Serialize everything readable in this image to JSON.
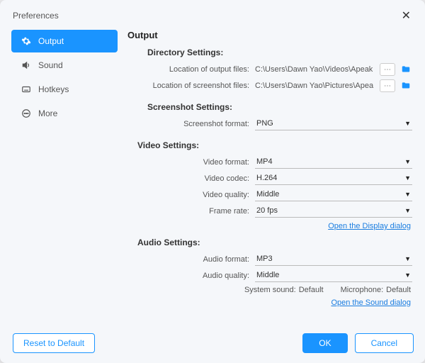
{
  "title": "Preferences",
  "sidebar": {
    "items": [
      {
        "label": "Output"
      },
      {
        "label": "Sound"
      },
      {
        "label": "Hotkeys"
      },
      {
        "label": "More"
      }
    ]
  },
  "main": {
    "heading": "Output",
    "directory": {
      "title": "Directory Settings:",
      "output_label": "Location of output files:",
      "output_path": "C:\\Users\\Dawn Yao\\Videos\\Apeak",
      "screenshot_label": "Location of screenshot files:",
      "screenshot_path": "C:\\Users\\Dawn Yao\\Pictures\\Apea"
    },
    "screenshot": {
      "title": "Screenshot Settings:",
      "format_label": "Screenshot format:",
      "format_value": "PNG"
    },
    "video": {
      "title": "Video Settings:",
      "format_label": "Video format:",
      "format_value": "MP4",
      "codec_label": "Video codec:",
      "codec_value": "H.264",
      "quality_label": "Video quality:",
      "quality_value": "Middle",
      "frame_label": "Frame rate:",
      "frame_value": "20 fps",
      "display_link": "Open the Display dialog"
    },
    "audio": {
      "title": "Audio Settings:",
      "format_label": "Audio format:",
      "format_value": "MP3",
      "quality_label": "Audio quality:",
      "quality_value": "Middle",
      "system_label": "System sound:",
      "system_value": "Default",
      "mic_label": "Microphone:",
      "mic_value": "Default",
      "sound_link": "Open the Sound dialog"
    }
  },
  "footer": {
    "reset": "Reset to Default",
    "ok": "OK",
    "cancel": "Cancel"
  }
}
